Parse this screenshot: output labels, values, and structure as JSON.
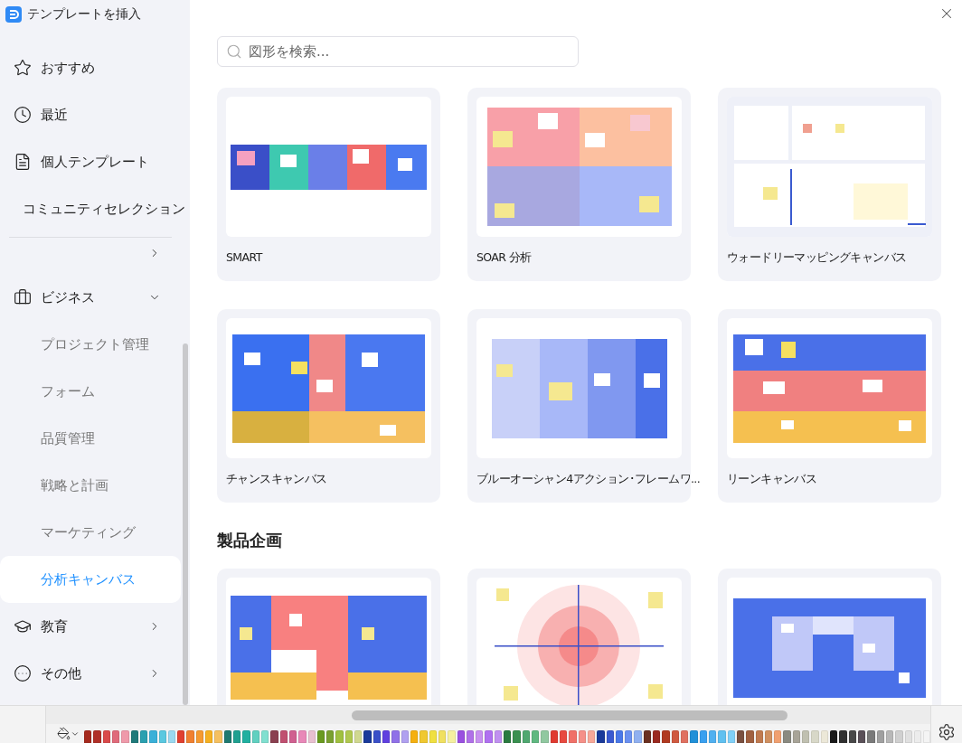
{
  "dialog": {
    "title": "テンプレートを挿入"
  },
  "nav": [
    {
      "label": "おすすめ"
    },
    {
      "label": "最近"
    },
    {
      "label": "個人テンプレート"
    },
    {
      "label": "コミュニティセレクション"
    }
  ],
  "categories": [
    {
      "kind": "clipped",
      "expanded": false
    },
    {
      "kind": "category",
      "label": "ビジネス",
      "expanded": true,
      "children": [
        {
          "label": "プロジェクト管理",
          "selected": false
        },
        {
          "label": "フォーム",
          "selected": false
        },
        {
          "label": "品質管理",
          "selected": false
        },
        {
          "label": "戦略と計画",
          "selected": false
        },
        {
          "label": "マーケティング",
          "selected": false
        },
        {
          "label": "分析キャンバス",
          "selected": true
        }
      ]
    },
    {
      "kind": "category",
      "label": "教育",
      "expanded": false
    },
    {
      "kind": "category",
      "label": "その他",
      "expanded": false
    }
  ],
  "search": {
    "placeholder": "図形を検索..."
  },
  "sections": [
    {
      "cards": [
        {
          "title": "SMART"
        },
        {
          "title": "SOAR 分析"
        },
        {
          "title": "ウォードリーマッピングキャンバス"
        },
        {
          "title": "チャンスキャンバス"
        },
        {
          "title": "ブルーオーシャン4アクション･フレームワ..."
        },
        {
          "title": "リーンキャンバス"
        }
      ]
    },
    {
      "title": "製品企画"
    }
  ],
  "palette": [
    {
      "color": "#a52a1e"
    },
    {
      "color": "#b03028"
    },
    {
      "color": "#d94a4a"
    },
    {
      "color": "#e06a7a"
    },
    {
      "color": "#ef9aaa"
    },
    {
      "color": "#1f7a7a"
    },
    {
      "color": "#2aa0b0"
    },
    {
      "color": "#3ab0d8"
    },
    {
      "color": "#5ac8e0"
    },
    {
      "color": "#9ad8f0"
    },
    {
      "color": "#e04030"
    },
    {
      "color": "#f08030"
    },
    {
      "color": "#f59a30"
    },
    {
      "color": "#f5b020"
    },
    {
      "color": "#f5c060"
    },
    {
      "color": "#1f7a70"
    },
    {
      "color": "#20a090"
    },
    {
      "color": "#20b0a0"
    },
    {
      "color": "#60d0c0"
    },
    {
      "color": "#80e0d0"
    },
    {
      "color": "#8a4050"
    },
    {
      "color": "#c05070"
    },
    {
      "color": "#d06090"
    },
    {
      "color": "#e888b8"
    },
    {
      "color": "#e8c0d0"
    },
    {
      "color": "#6a9a20"
    },
    {
      "color": "#7aa030"
    },
    {
      "color": "#a0c040"
    },
    {
      "color": "#b0c850"
    },
    {
      "color": "#d0d890"
    },
    {
      "color": "#1a3a9a"
    },
    {
      "color": "#3a50c8"
    },
    {
      "color": "#6040e0"
    },
    {
      "color": "#9070e8"
    },
    {
      "color": "#b0a0f0"
    },
    {
      "color": "#f5b010"
    },
    {
      "color": "#f0c830"
    },
    {
      "color": "#f0e040"
    },
    {
      "color": "#f0e060"
    },
    {
      "color": "#f5f0a0"
    },
    {
      "color": "#9a50e0"
    },
    {
      "color": "#b070e8"
    },
    {
      "color": "#c890f0"
    },
    {
      "color": "#b070f0"
    },
    {
      "color": "#c090f0"
    },
    {
      "color": "#2a7a40"
    },
    {
      "color": "#3a9050"
    },
    {
      "color": "#50a870"
    },
    {
      "color": "#60b880"
    },
    {
      "color": "#90c8a0"
    },
    {
      "color": "#e03a30"
    },
    {
      "color": "#e84a40"
    },
    {
      "color": "#f07068"
    },
    {
      "color": "#f59088"
    },
    {
      "color": "#f8a898"
    },
    {
      "color": "#1a3a9a"
    },
    {
      "color": "#3a5ad0"
    },
    {
      "color": "#4a78e8"
    },
    {
      "color": "#6a90f0"
    },
    {
      "color": "#90b0f0"
    },
    {
      "color": "#6a3020"
    },
    {
      "color": "#9a2a20"
    },
    {
      "color": "#b03a20"
    },
    {
      "color": "#d05a40"
    },
    {
      "color": "#e07060"
    },
    {
      "color": "#2090d8"
    },
    {
      "color": "#3aa0f0"
    },
    {
      "color": "#50b0f0"
    },
    {
      "color": "#60c0f0"
    },
    {
      "color": "#80d0f8"
    },
    {
      "color": "#7a5040"
    },
    {
      "color": "#a06040"
    },
    {
      "color": "#c07a50"
    },
    {
      "color": "#d09060"
    },
    {
      "color": "#f0a070"
    },
    {
      "color": "#8a8a80"
    },
    {
      "color": "#a8a498"
    },
    {
      "color": "#c0c0b0"
    },
    {
      "color": "#d8d8c8"
    },
    {
      "color": "#ece8d8"
    },
    {
      "color": "#1a1a1a"
    },
    {
      "color": "#303030"
    },
    {
      "color": "#484848"
    },
    {
      "color": "#5a5058"
    },
    {
      "color": "#7a7a7a"
    },
    {
      "color": "#a0a0a0"
    },
    {
      "color": "#b8b8b8"
    },
    {
      "color": "#d0d0d0"
    },
    {
      "color": "#e0e0e0"
    },
    {
      "color": "#ececec"
    },
    {
      "color": "#f4f4f4"
    }
  ]
}
